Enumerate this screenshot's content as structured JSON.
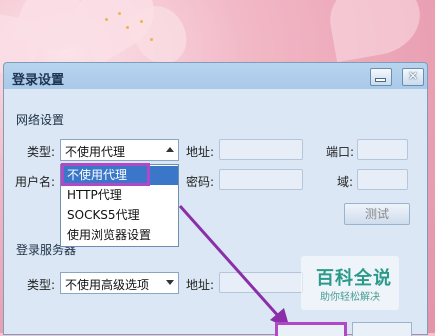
{
  "dialog": {
    "title": "登录设置"
  },
  "network": {
    "section_title": "网络设置",
    "type_label": "类型:",
    "type_value": "不使用代理",
    "address_label": "地址:",
    "port_label": "端口:",
    "username_label": "用户名:",
    "password_label": "密码:",
    "domain_label": "域:",
    "test_button": "测试"
  },
  "proxy_dropdown": {
    "options": [
      "不使用代理",
      "HTTP代理",
      "SOCKS5代理",
      "使用浏览器设置"
    ],
    "selected_index": 0
  },
  "login_server": {
    "section_title": "登录服务器",
    "type_label": "类型:",
    "type_value": "不使用高级选项",
    "address_label": "地址:"
  },
  "watermark": {
    "title": "百科全说",
    "subtitle": "助你轻松解决"
  },
  "colors": {
    "highlight": "#b048c7",
    "selection": "#3a77c9",
    "arrow": "#8b2fa8"
  }
}
